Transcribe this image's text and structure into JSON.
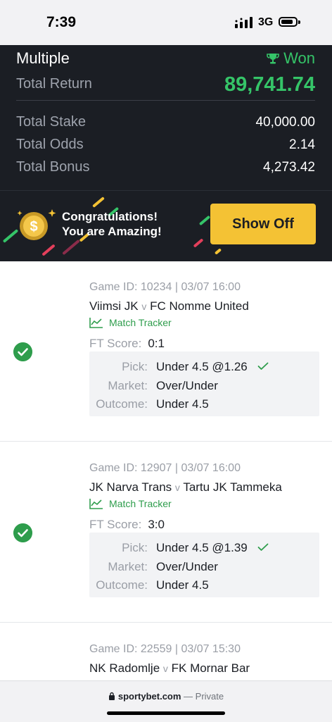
{
  "status_bar": {
    "time": "7:39",
    "network": "3G"
  },
  "summary": {
    "bet_type": "Multiple",
    "result": "Won",
    "total_return_label": "Total Return",
    "total_return": "89,741.74",
    "total_stake_label": "Total Stake",
    "total_stake": "40,000.00",
    "total_odds_label": "Total Odds",
    "total_odds": "2.14",
    "total_bonus_label": "Total Bonus",
    "total_bonus": "4,273.42"
  },
  "banner": {
    "line1": "Congratulations!",
    "line2": "You are Amazing!",
    "button": "Show Off"
  },
  "bets": [
    {
      "game_id": "Game ID: 10234 | 03/07 16:00",
      "home": "Viimsi JK",
      "vs": "v",
      "away": "FC Nomme United",
      "tracker": "Match Tracker",
      "ft_label": "FT Score:",
      "ft_score": "0:1",
      "pick_label": "Pick:",
      "pick": "Under 4.5 @1.26",
      "market_label": "Market:",
      "market": "Over/Under",
      "outcome_label": "Outcome:",
      "outcome": "Under 4.5"
    },
    {
      "game_id": "Game ID: 12907 | 03/07 16:00",
      "home": "JK Narva Trans",
      "vs": "v",
      "away": "Tartu JK Tammeka",
      "tracker": "Match Tracker",
      "ft_label": "FT Score:",
      "ft_score": "3:0",
      "pick_label": "Pick:",
      "pick": "Under 4.5 @1.39",
      "market_label": "Market:",
      "market": "Over/Under",
      "outcome_label": "Outcome:",
      "outcome": "Under 4.5"
    },
    {
      "game_id": "Game ID: 22559 | 03/07 15:30",
      "home": "NK Radomlje",
      "vs": "v",
      "away": "FK Mornar Bar"
    }
  ],
  "footer": {
    "domain": "sportybet.com",
    "suffix": " — Private"
  },
  "colors": {
    "won_green": "#35c468",
    "check_green": "#2e9d4c",
    "button_yellow": "#f4c234",
    "dark_bg": "#1b1e24"
  }
}
